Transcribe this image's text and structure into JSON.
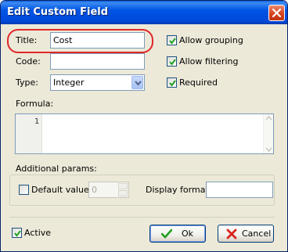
{
  "window": {
    "title": "Edit Custom Field"
  },
  "fields": {
    "title_label": "Title:",
    "title_value": "Cost",
    "code_label": "Code:",
    "code_value": "",
    "type_label": "Type:",
    "type_value": "Integer"
  },
  "options": {
    "allow_grouping": {
      "label": "Allow grouping",
      "checked": true
    },
    "allow_filtering": {
      "label": "Allow filtering",
      "checked": true
    },
    "required": {
      "label": "Required",
      "checked": true
    }
  },
  "formula": {
    "label": "Formula:",
    "line_number": "1",
    "text": ""
  },
  "additional": {
    "label": "Additional params:",
    "default_value": {
      "label": "Default value:",
      "checked": false,
      "value": "0"
    },
    "display_format": {
      "label": "Display format:",
      "value": ""
    }
  },
  "active": {
    "label": "Active",
    "checked": true
  },
  "buttons": {
    "ok": "Ok",
    "cancel": "Cancel"
  },
  "colors": {
    "titlebar": "#0055e5",
    "highlight": "#e0282a",
    "check": "#21a121",
    "cancel_x": "#d8261e"
  }
}
